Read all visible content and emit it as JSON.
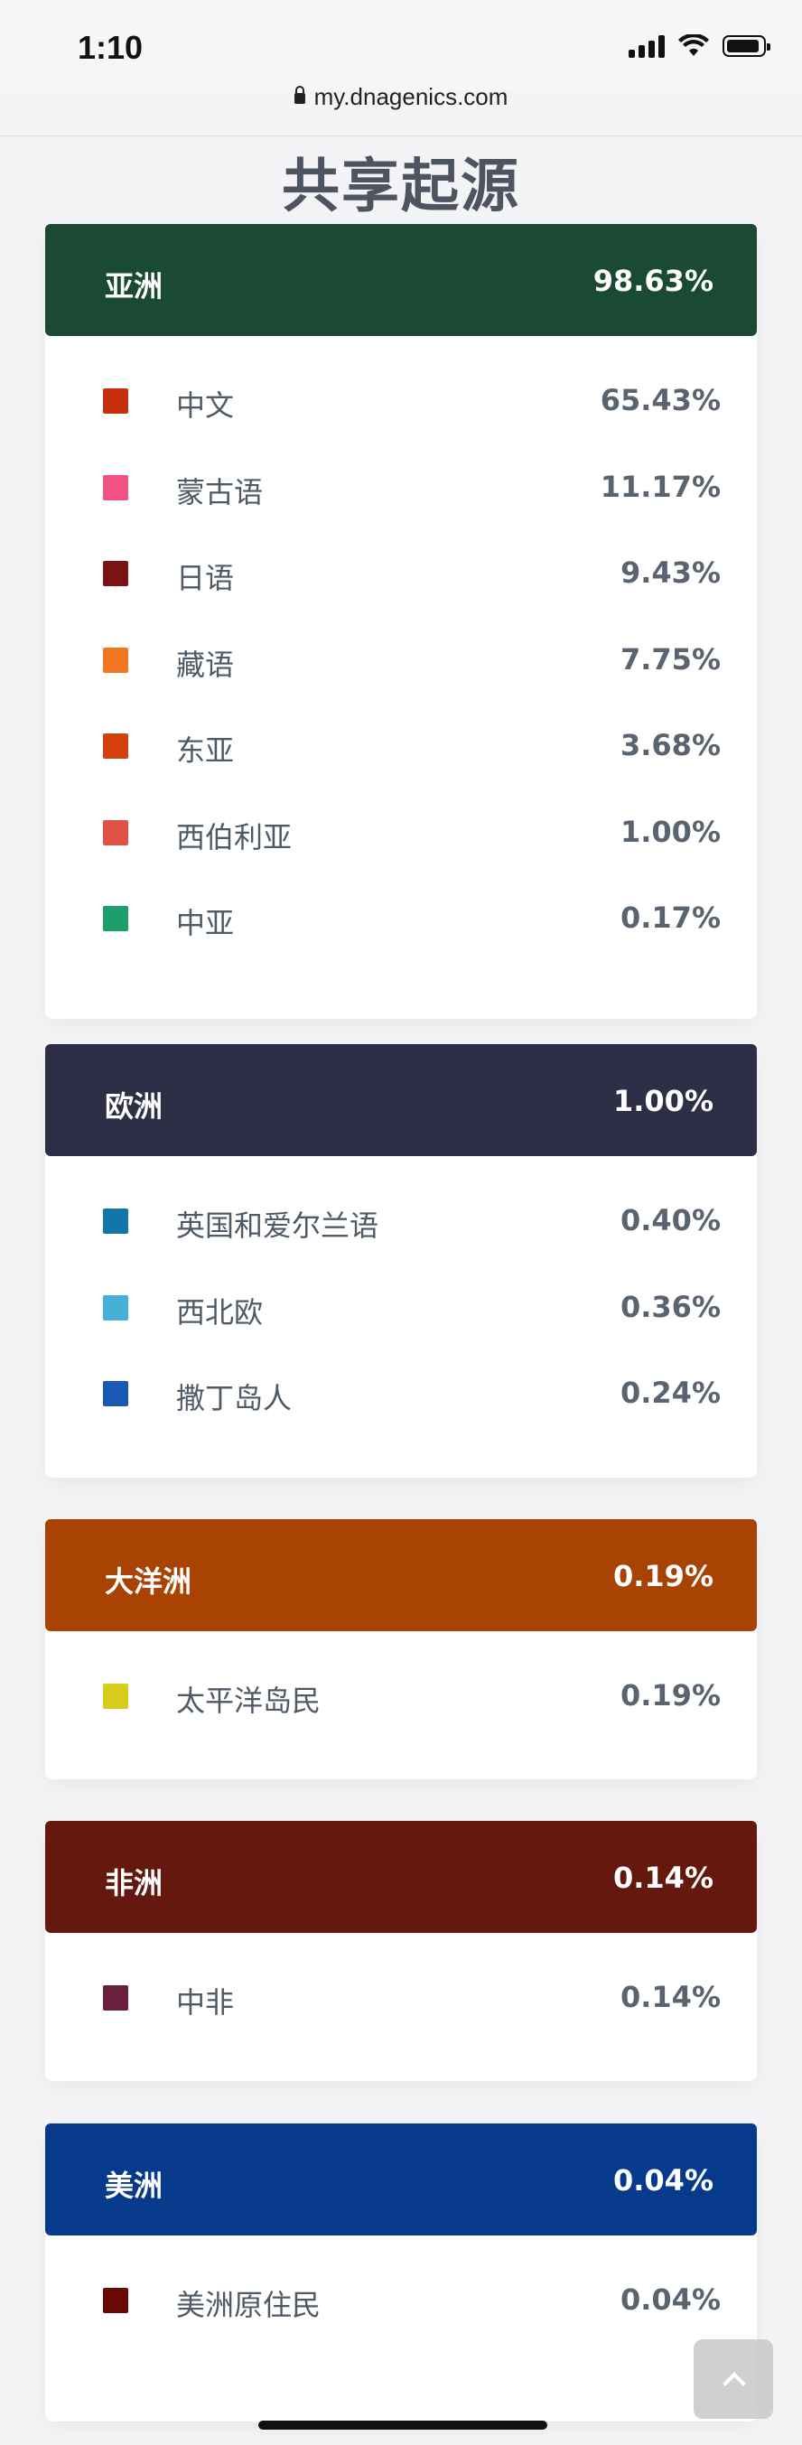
{
  "status_bar": {
    "time": "1:10"
  },
  "browser": {
    "url": "my.dnagenics.com"
  },
  "page": {
    "title": "共享起源"
  },
  "regions": [
    {
      "name": "亚洲",
      "percent": "98.63%",
      "color": "#1b4a34",
      "items": [
        {
          "label": "中文",
          "percent": "65.43%",
          "color": "#c4300e"
        },
        {
          "label": "蒙古语",
          "percent": "11.17%",
          "color": "#ef5283"
        },
        {
          "label": "日语",
          "percent": "9.43%",
          "color": "#7a1414"
        },
        {
          "label": "藏语",
          "percent": "7.75%",
          "color": "#f47622"
        },
        {
          "label": "东亚",
          "percent": "3.68%",
          "color": "#d2410e"
        },
        {
          "label": "西伯利亚",
          "percent": "1.00%",
          "color": "#e25147"
        },
        {
          "label": "中亚",
          "percent": "0.17%",
          "color": "#1e9e6a"
        }
      ]
    },
    {
      "name": "欧洲",
      "percent": "1.00%",
      "color": "#2e2f47",
      "items": [
        {
          "label": "英国和爱尔兰语",
          "percent": "0.40%",
          "color": "#1475aa"
        },
        {
          "label": "西北欧",
          "percent": "0.36%",
          "color": "#46b1d6"
        },
        {
          "label": "撒丁岛人",
          "percent": "0.24%",
          "color": "#1a58b6"
        }
      ]
    },
    {
      "name": "大洋洲",
      "percent": "0.19%",
      "color": "#a84304",
      "items": [
        {
          "label": "太平洋岛民",
          "percent": "0.19%",
          "color": "#d8cc1a"
        }
      ]
    },
    {
      "name": "非洲",
      "percent": "0.14%",
      "color": "#65180d",
      "items": [
        {
          "label": "中非",
          "percent": "0.14%",
          "color": "#6a1f3c"
        }
      ]
    },
    {
      "name": "美洲",
      "percent": "0.04%",
      "color": "#083a8c",
      "items": [
        {
          "label": "美洲原住民",
          "percent": "0.04%",
          "color": "#6a0808"
        }
      ]
    }
  ]
}
